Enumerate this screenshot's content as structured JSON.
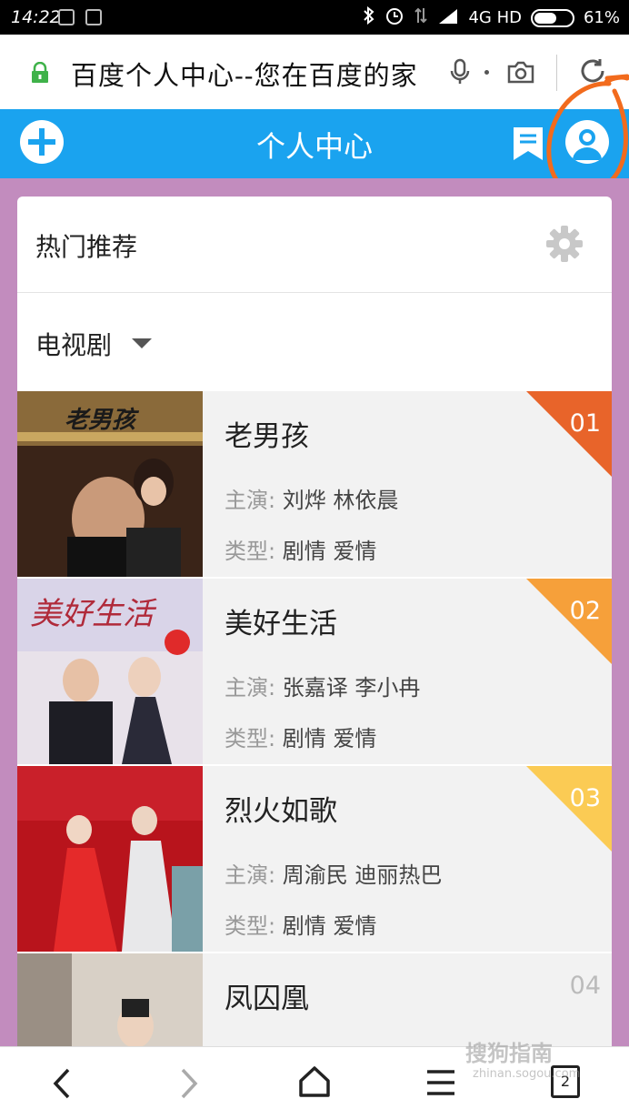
{
  "status_bar": {
    "time": "14:22",
    "network": "4G HD",
    "battery": "61%",
    "battery_level": 0.61
  },
  "browser": {
    "url_title": "百度个人中心--您在百度的家"
  },
  "app_header": {
    "title": "个人中心"
  },
  "section": {
    "title": "热门推荐",
    "filter_label": "电视剧"
  },
  "list": [
    {
      "rank": "01",
      "name": "老男孩",
      "cast_label": "主演:",
      "cast": "刘烨 林依晨",
      "genre_label": "类型:",
      "genre": "剧情 爱情",
      "rank_color": "#e8642a",
      "poster_text": "老男孩"
    },
    {
      "rank": "02",
      "name": "美好生活",
      "cast_label": "主演:",
      "cast": "张嘉译 李小冉",
      "genre_label": "类型:",
      "genre": "剧情 爱情",
      "rank_color": "#f6a03a",
      "poster_text": "美好生活"
    },
    {
      "rank": "03",
      "name": "烈火如歌",
      "cast_label": "主演:",
      "cast": "周渝民 迪丽热巴",
      "genre_label": "类型:",
      "genre": "剧情 爱情",
      "rank_color": "#fbcb54",
      "poster_text": ""
    },
    {
      "rank": "04",
      "name": "凤囚凰",
      "rank_color": "none",
      "poster_text": ""
    }
  ],
  "bottom_nav": {
    "tab_count": "2"
  },
  "watermark": {
    "text": "搜狗指南",
    "url": "zhinan.sogou.com"
  }
}
